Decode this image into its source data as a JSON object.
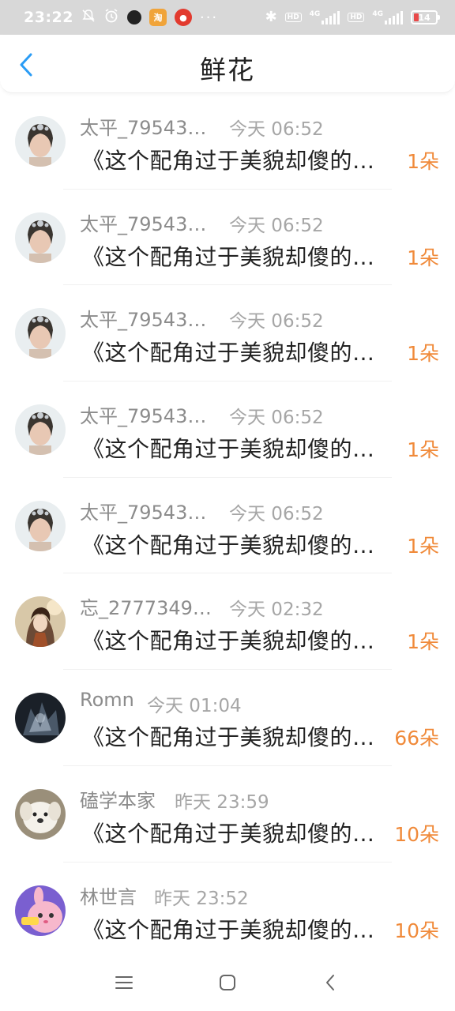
{
  "status_bar": {
    "time": "23:22",
    "icons": [
      "mute-icon",
      "alarm-icon",
      "app-icon",
      "taobao-icon",
      "redbag-icon"
    ],
    "dots": "···",
    "bluetooth": "✱",
    "hd1": "HD",
    "net1": "4G",
    "hd2": "HD",
    "net2": "4G",
    "battery": "14"
  },
  "header": {
    "title": "鲜花"
  },
  "items": [
    {
      "name": "太平_79543…",
      "time": "今天 06:52",
      "text": "《这个配角过于美貌却傻的…",
      "count": "1朵",
      "avatar": "woman"
    },
    {
      "name": "太平_79543…",
      "time": "今天 06:52",
      "text": "《这个配角过于美貌却傻的…",
      "count": "1朵",
      "avatar": "woman"
    },
    {
      "name": "太平_79543…",
      "time": "今天 06:52",
      "text": "《这个配角过于美貌却傻的…",
      "count": "1朵",
      "avatar": "woman"
    },
    {
      "name": "太平_79543…",
      "time": "今天 06:52",
      "text": "《这个配角过于美貌却傻的…",
      "count": "1朵",
      "avatar": "woman"
    },
    {
      "name": "太平_79543…",
      "time": "今天 06:52",
      "text": "《这个配角过于美貌却傻的…",
      "count": "1朵",
      "avatar": "woman"
    },
    {
      "name": "忘_2777349…",
      "time": "今天 02:32",
      "text": "《这个配角过于美貌却傻的…",
      "count": "1朵",
      "avatar": "anime"
    },
    {
      "name": "Romn",
      "time": "今天 01:04",
      "text": "《这个配角过于美貌却傻的…",
      "count": "66朵",
      "avatar": "dark"
    },
    {
      "name": "磕学本家",
      "time": "昨天 23:59",
      "text": "《这个配角过于美貌却傻的…",
      "count": "10朵",
      "avatar": "dog"
    },
    {
      "name": "林世言",
      "time": "昨天 23:52",
      "text": "《这个配角过于美貌却傻的…",
      "count": "10朵",
      "avatar": "bunny"
    }
  ],
  "nav": {
    "menu": "menu-icon",
    "home": "home-icon",
    "back": "back-icon"
  },
  "colors": {
    "accent_blue": "#2a9cf5",
    "count_orange": "#f08a3a",
    "status_bar_bg": "#d8d8d8"
  }
}
